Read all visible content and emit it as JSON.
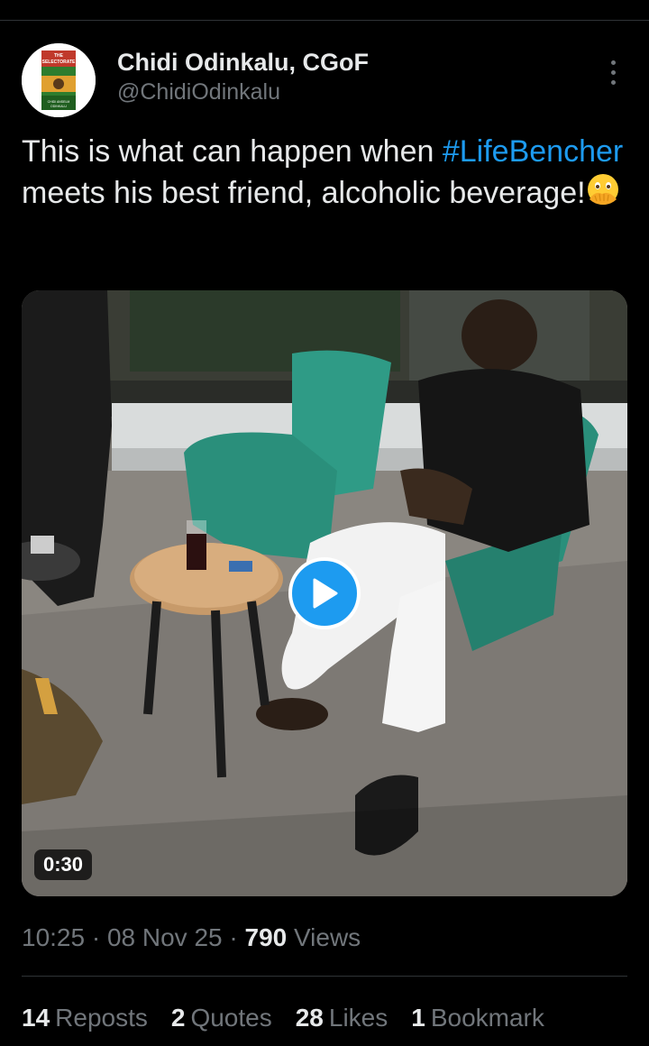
{
  "colors": {
    "background": "#000000",
    "text": "#e7e9ea",
    "secondary": "#71767b",
    "accent": "#1d9bf0",
    "divider": "#2f3336"
  },
  "author": {
    "display_name": "Chidi Odinkalu, CGoF",
    "handle": "@ChidiOdinkalu",
    "avatar_icon": "book-cover-avatar",
    "avatar_title": "THE SELECTORATE",
    "avatar_subtitle": "OBIOMA NNAEMEKA",
    "avatar_byline": "CHIDI ANSELM ODINKALU"
  },
  "more_icon": "more-vertical-icon",
  "tweet": {
    "text_before": "This is what can happen when ",
    "hashtag": "#LifeBencher",
    "text_after": " meets his best friend, alcoholic beverage!",
    "emoji": "face-with-open-eyes-and-hand-over-mouth"
  },
  "media": {
    "type": "video",
    "duration": "0:30",
    "play_icon": "play-icon"
  },
  "meta": {
    "time": "10:25",
    "separator": " · ",
    "date": "08 Nov 25",
    "views_count": "790",
    "views_label": " Views"
  },
  "stats": {
    "reposts": {
      "count": "14",
      "label": "Reposts"
    },
    "quotes": {
      "count": "2",
      "label": "Quotes"
    },
    "likes": {
      "count": "28",
      "label": "Likes"
    },
    "bookmarks": {
      "count": "1",
      "label": "Bookmark"
    }
  }
}
